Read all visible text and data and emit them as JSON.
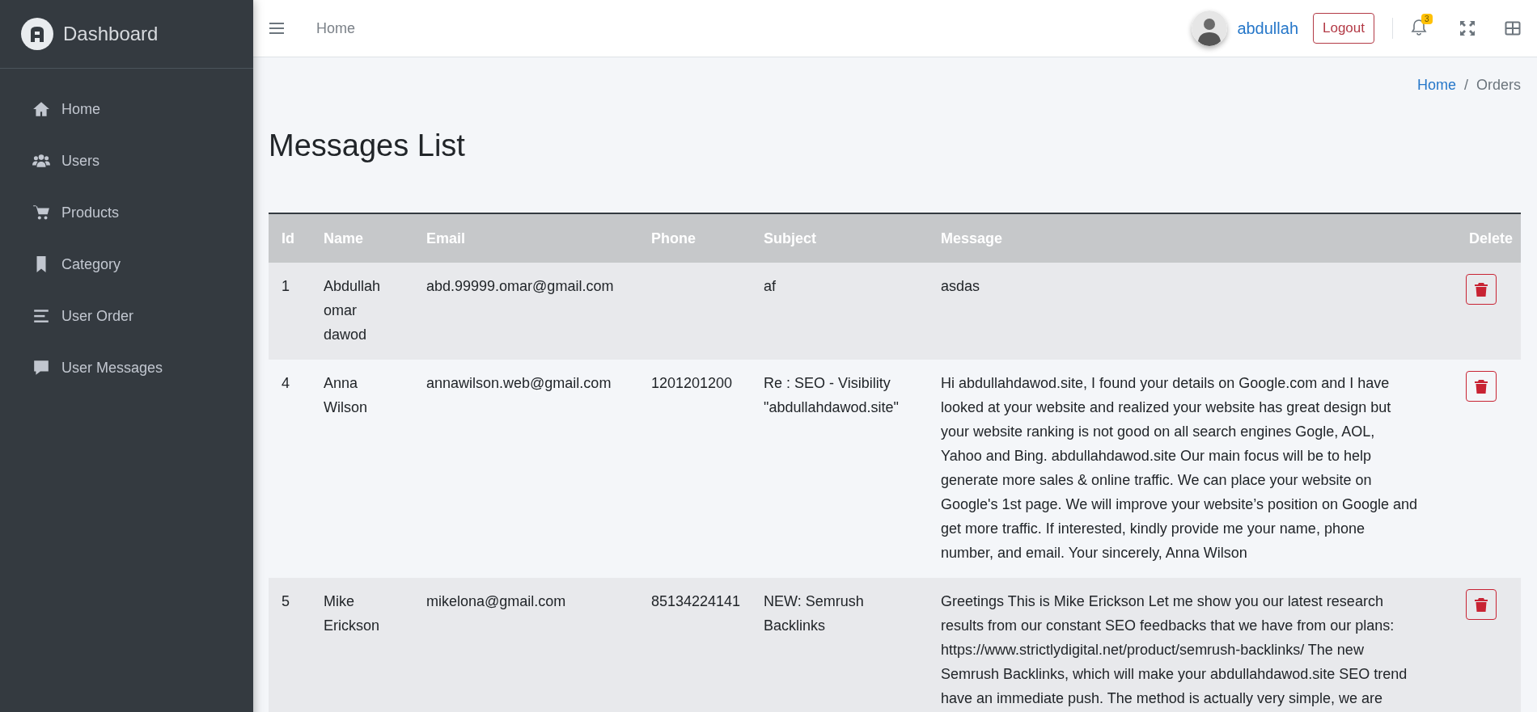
{
  "sidebar": {
    "brand": "Dashboard",
    "items": [
      {
        "label": "Home"
      },
      {
        "label": "Users"
      },
      {
        "label": "Products"
      },
      {
        "label": "Category"
      },
      {
        "label": "User Order"
      },
      {
        "label": "User Messages"
      }
    ]
  },
  "topbar": {
    "nav_link": "Home",
    "user_name": "abdullah",
    "logout": "Logout",
    "notification_count": "3"
  },
  "breadcrumb_separator": "/",
  "breadcrumb": [
    {
      "label": "Home",
      "active": false
    },
    {
      "label": "Orders",
      "active": true
    }
  ],
  "title": "Messages List",
  "table": {
    "columns": [
      "Id",
      "Name",
      "Email",
      "Phone",
      "Subject",
      "Message",
      "Delete"
    ],
    "rows": [
      {
        "id": "1",
        "name": "Abdullah omar dawod",
        "email": "abd.99999.omar@gmail.com",
        "subject": "af",
        "message": "asdas"
      },
      {
        "id": "4",
        "name": "Anna Wilson",
        "email": "annawilson.web@gmail.com",
        "phone": "1201201200",
        "subject": "Re : SEO - Visibility \"abdullahdawod.site\"",
        "message": "Hi abdullahdawod.site, I found your details on Google.com and I have looked at your website and realized your website has great design but your website ranking is not good on all search engines Gogle, AOL, Yahoo and Bing. abdullahdawod.site Our main focus will be to help generate more sales & online traffic. We can place your website on Google's 1st page. We will improve your website’s position on Google and get more traffic. If interested, kindly provide me your name, phone number, and email. Your sincerely, Anna Wilson"
      },
      {
        "id": "5",
        "name": "Mike Erickson",
        "email": "mikelona@gmail.com",
        "phone": "85134224141",
        "subject": "NEW: Semrush Backlinks",
        "message": "Greetings This is Mike Erickson Let me show you our latest research results from our constant SEO feedbacks that we have from our plans: https://www.strictlydigital.net/product/semrush-backlinks/ The new Semrush Backlinks, which will make your abdullahdawod.site SEO trend have an immediate push. The method is actually very simple, we are"
      }
    ]
  }
}
